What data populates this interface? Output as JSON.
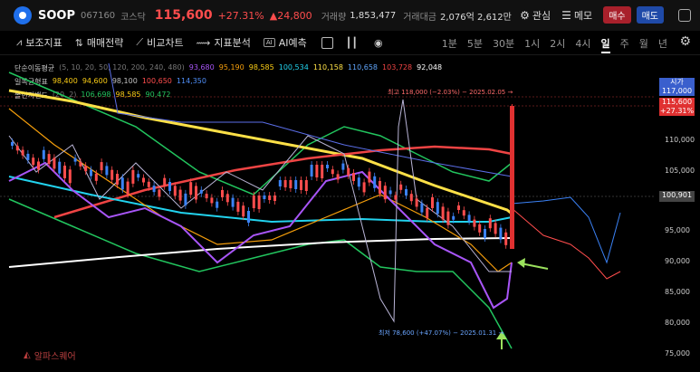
{
  "header": {
    "symbol": "SOOP",
    "code": "067160",
    "market": "코스닥",
    "price": "115,600",
    "change_pct": "+27.31%",
    "change": "▲24,800",
    "volume_label": "거래량",
    "volume": "1,853,477",
    "amount_label": "거래대금",
    "amount": "2,076억 2,612만",
    "watch_label": "관심",
    "memo_label": "메모",
    "buy_label": "매수",
    "sell_label": "매도"
  },
  "toolbar": {
    "items": [
      "보조지표",
      "매매전략",
      "비교차트",
      "지표분석",
      "AI예측"
    ],
    "ai_badge": "AI",
    "periods": [
      "1분",
      "5분",
      "30분",
      "1시",
      "2시",
      "4시",
      "일",
      "주",
      "월",
      "년"
    ],
    "active_period": "일"
  },
  "legend": {
    "ma": {
      "label": "단순이동평균",
      "params": "(5, 10, 20, 50, 120, 200, 240, 480)",
      "values": [
        "93,680",
        "95,190",
        "98,585",
        "100,534",
        "110,158",
        "110,658",
        "103,728",
        "92,048"
      ],
      "colors": [
        "#a855f7",
        "#f59e0b",
        "#facc15",
        "#22d3ee",
        "#fde047",
        "#60a5fa",
        "#ef4444",
        "#ffffff"
      ]
    },
    "ichimoku": {
      "label": "일목균형표",
      "values": [
        "98,400",
        "94,600",
        "98,100",
        "100,650",
        "114,350"
      ],
      "colors": [
        "#facc15",
        "#facc15",
        "#c0c0c0",
        "#ff4d4d",
        "#4f8ef7"
      ]
    },
    "bollinger": {
      "label": "볼린저밴드",
      "params": "(20, 2)",
      "values": [
        "106,698",
        "98,585",
        "90,472"
      ],
      "colors": [
        "#22c55e",
        "#facc15",
        "#22c55e"
      ]
    }
  },
  "price_axis": {
    "ticks": [
      "110,000",
      "105,000",
      "100,000",
      "95,000",
      "90,000",
      "85,000",
      "80,000",
      "75,000"
    ],
    "open_price": "100,901",
    "open_label": "시가",
    "open_value": "117,000",
    "current_price": "115,600",
    "current_change": "+27.31%"
  },
  "annotations": {
    "high": "최고 118,000 (−2.03%) − 2025.02.05 →",
    "low": "최저 78,600 (+47.07%) − 2025.01.31 →"
  },
  "watermark": "알파스퀘어",
  "colors": {
    "up": "#ff4d4d",
    "down": "#3b82f6",
    "bg": "#000000"
  }
}
